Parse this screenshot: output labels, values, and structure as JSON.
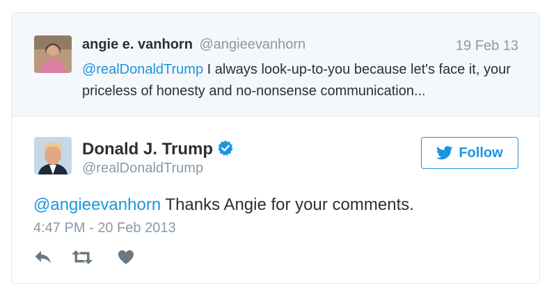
{
  "parent_tweet": {
    "author_name": "angie e. vanhorn",
    "author_handle": "@angieevanhorn",
    "date": "19 Feb 13",
    "mention": "@realDonaldTrump",
    "text": " I always look-up-to-you because let's face it, your priceless of honesty and no-nonsense communication..."
  },
  "tweet": {
    "author_name": "Donald J. Trump",
    "author_handle": "@realDonaldTrump",
    "follow_label": "Follow",
    "mention": "@angieevanhorn",
    "text": " Thanks Angie for your comments.",
    "timestamp": "4:47 PM - 20 Feb 2013"
  },
  "icons": {
    "verified": "verified-badge-icon",
    "follow": "twitter-bird-icon",
    "reply": "reply-icon",
    "retweet": "retweet-icon",
    "like": "heart-icon"
  },
  "colors": {
    "accent": "#1b95e0",
    "text": "#292f33",
    "muted": "#8899a6",
    "parent_bg": "#f5f8fa",
    "border": "#e1e8ed"
  }
}
